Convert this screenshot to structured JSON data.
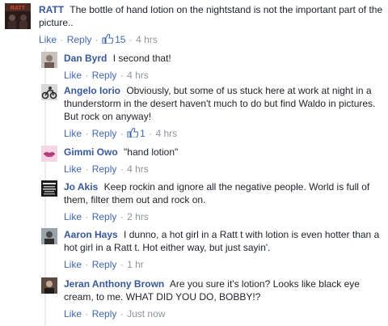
{
  "colors": {
    "name": "#365899",
    "link": "#4267b2",
    "meta": "#90949c",
    "text": "#1d2129"
  },
  "actions": {
    "like": "Like",
    "reply": "Reply",
    "separator": "·"
  },
  "top_comment": {
    "author": "RATT",
    "text": "The bottle of hand lotion on the nightstand is not the important part of the picture..",
    "likes": "15",
    "time": "4 hrs",
    "avatar_icon": "band-logo-avatar"
  },
  "replies": [
    {
      "author": "Dan Byrd",
      "text": "I second that!",
      "likes": "",
      "time": "4 hrs",
      "avatar_icon": "person-avatar"
    },
    {
      "author": "Angelo Iorio",
      "text": "Obviously, but some of us stuck here at work at night in a thunderstorm in the desert haven't much to do but find Waldo in pictures. But rock on anyway!",
      "likes": "1",
      "time": "4 hrs",
      "avatar_icon": "motorcycle-avatar"
    },
    {
      "author": "Gimmi Owo",
      "text": "\"hand lotion\"",
      "likes": "",
      "time": "4 hrs",
      "avatar_icon": "lips-avatar"
    },
    {
      "author": "Jo Akis",
      "text": "Keep rockin and ignore all the negative people. World is full of them, filter them out and rock on.",
      "likes": "",
      "time": "2 hrs",
      "avatar_icon": "poster-avatar"
    },
    {
      "author": "Aaron Hays",
      "text": "I dunno, a hot girl in a Ratt t with lotion is even hotter than a hot girl in a Ratt t. Hot either way, but just sayin'.",
      "likes": "",
      "time": "1 hr",
      "avatar_icon": "person-avatar"
    },
    {
      "author": "Jeran Anthony Brown",
      "text": "Are you sure it's lotion? Looks like black eye cream, to me. WHAT DID YOU DO, BOBBY!?",
      "likes": "",
      "time": "Just now",
      "avatar_icon": "person-dark-avatar"
    }
  ]
}
